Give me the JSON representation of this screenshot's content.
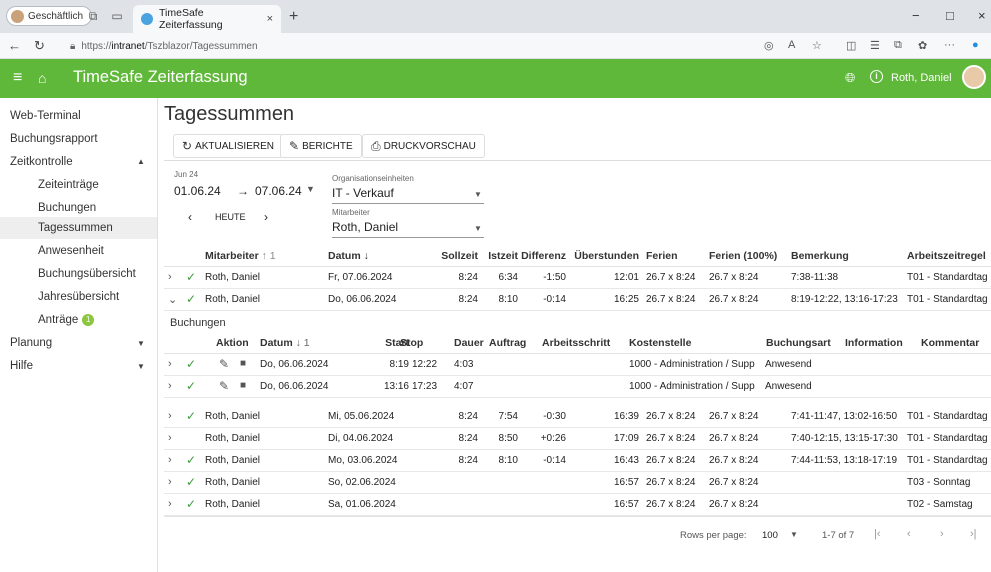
{
  "browser": {
    "profile": "Geschäftlich",
    "tab_title": "TimeSafe Zeiterfassung",
    "tab_close": "×",
    "new_tab": "+",
    "url_prefix": "https://",
    "url_host": "intranet",
    "url_path": "/Tszblazor/Tagessummen",
    "win_min": "−",
    "win_max": "□",
    "win_close": "×"
  },
  "app": {
    "title": "TimeSafe Zeiterfassung",
    "user": "Roth, Daniel",
    "accent": "#5fb83a"
  },
  "sidebar": {
    "items": [
      {
        "label": "Web-Terminal"
      },
      {
        "label": "Buchungsrapport"
      },
      {
        "label": "Zeitkontrolle"
      },
      {
        "label": "Zeiteinträge"
      },
      {
        "label": "Buchungen"
      },
      {
        "label": "Tagessummen"
      },
      {
        "label": "Anwesenheit"
      },
      {
        "label": "Buchungsübersicht"
      },
      {
        "label": "Jahresübersicht"
      },
      {
        "label": "Anträge",
        "badge": "1"
      },
      {
        "label": "Planung"
      },
      {
        "label": "Hilfe"
      }
    ]
  },
  "page": {
    "title": "Tagessummen"
  },
  "toolbar": {
    "refresh": "AKTUALISIEREN",
    "reports": "BERICHTE",
    "print": "DRUCKVORSCHAU"
  },
  "filters": {
    "month": "Jun 24",
    "from": "01.06.24",
    "arrow": "→",
    "to": "07.06.24",
    "today": "HEUTE",
    "prev": "‹",
    "next": "›",
    "org_label": "Organisationseinheiten",
    "org_value": "IT - Verkauf",
    "emp_label": "Mitarbeiter",
    "emp_value": "Roth, Daniel"
  },
  "grid": {
    "headers": {
      "employee": "Mitarbeiter",
      "employee_sort": "↑ 1",
      "date": "Datum",
      "date_sort": "↓",
      "target": "Sollzeit",
      "actual": "Istzeit",
      "diff": "Differenz",
      "overtime": "Überstunden",
      "vacation": "Ferien",
      "vacation100": "Ferien (100%)",
      "remark": "Bemerkung",
      "rule": "Arbeitszeitregel"
    },
    "rows": [
      {
        "exp": "›",
        "check": true,
        "employee": "Roth, Daniel",
        "date": "Fr, 07.06.2024",
        "target": "8:24",
        "actual": "6:34",
        "diff": "-1:50",
        "overtime": "12:01",
        "vacation": "26.7 x 8:24",
        "vacation100": "26.7 x 8:24",
        "remark": "7:38-11:38",
        "rule": "T01 - Standardtag"
      },
      {
        "exp": "⌄",
        "check": true,
        "employee": "Roth, Daniel",
        "date": "Do, 06.06.2024",
        "target": "8:24",
        "actual": "8:10",
        "diff": "-0:14",
        "overtime": "16:25",
        "vacation": "26.7 x 8:24",
        "vacation100": "26.7 x 8:24",
        "remark": "8:19-12:22, 13:16-17:23",
        "rule": "T01 - Standardtag"
      },
      {
        "exp": "›",
        "check": true,
        "employee": "Roth, Daniel",
        "date": "Mi, 05.06.2024",
        "target": "8:24",
        "actual": "7:54",
        "diff": "-0:30",
        "overtime": "16:39",
        "vacation": "26.7 x 8:24",
        "vacation100": "26.7 x 8:24",
        "remark": "7:41-11:47, 13:02-16:50",
        "rule": "T01 - Standardtag"
      },
      {
        "exp": "›",
        "check": false,
        "employee": "Roth, Daniel",
        "date": "Di, 04.06.2024",
        "target": "8:24",
        "actual": "8:50",
        "diff": "+0:26",
        "overtime": "17:09",
        "vacation": "26.7 x 8:24",
        "vacation100": "26.7 x 8:24",
        "remark": "7:40-12:15, 13:15-17:30",
        "rule": "T01 - Standardtag"
      },
      {
        "exp": "›",
        "check": true,
        "employee": "Roth, Daniel",
        "date": "Mo, 03.06.2024",
        "target": "8:24",
        "actual": "8:10",
        "diff": "-0:14",
        "overtime": "16:43",
        "vacation": "26.7 x 8:24",
        "vacation100": "26.7 x 8:24",
        "remark": "7:44-11:53, 13:18-17:19",
        "rule": "T01 - Standardtag"
      },
      {
        "exp": "›",
        "check": true,
        "employee": "Roth, Daniel",
        "date": "So, 02.06.2024",
        "target": "",
        "actual": "",
        "diff": "",
        "overtime": "16:57",
        "vacation": "26.7 x 8:24",
        "vacation100": "26.7 x 8:24",
        "remark": "",
        "rule": "T03 - Sonntag"
      },
      {
        "exp": "›",
        "check": true,
        "employee": "Roth, Daniel",
        "date": "Sa, 01.06.2024",
        "target": "",
        "actual": "",
        "diff": "",
        "overtime": "16:57",
        "vacation": "26.7 x 8:24",
        "vacation100": "26.7 x 8:24",
        "remark": "",
        "rule": "T02 - Samstag"
      }
    ],
    "sub": {
      "title": "Buchungen",
      "headers": {
        "action": "Aktion",
        "date": "Datum",
        "date_sort": "↓ 1",
        "start": "Start",
        "stop": "Stop",
        "duration": "Dauer",
        "order": "Auftrag",
        "step": "Arbeitsschritt",
        "cost": "Kostenstelle",
        "type": "Buchungsart",
        "info": "Information",
        "comment": "Kommentar"
      },
      "rows": [
        {
          "date": "Do, 06.06.2024",
          "start": "8:19",
          "stop": "12:22",
          "duration": "4:03",
          "cost": "1000 - Administration / Supp",
          "type": "Anwesend"
        },
        {
          "date": "Do, 06.06.2024",
          "start": "13:16",
          "stop": "17:23",
          "duration": "4:07",
          "cost": "1000 - Administration / Supp",
          "type": "Anwesend"
        }
      ]
    }
  },
  "pager": {
    "rows_label": "Rows per page:",
    "rows_value": "100",
    "range": "1-7 of 7"
  }
}
